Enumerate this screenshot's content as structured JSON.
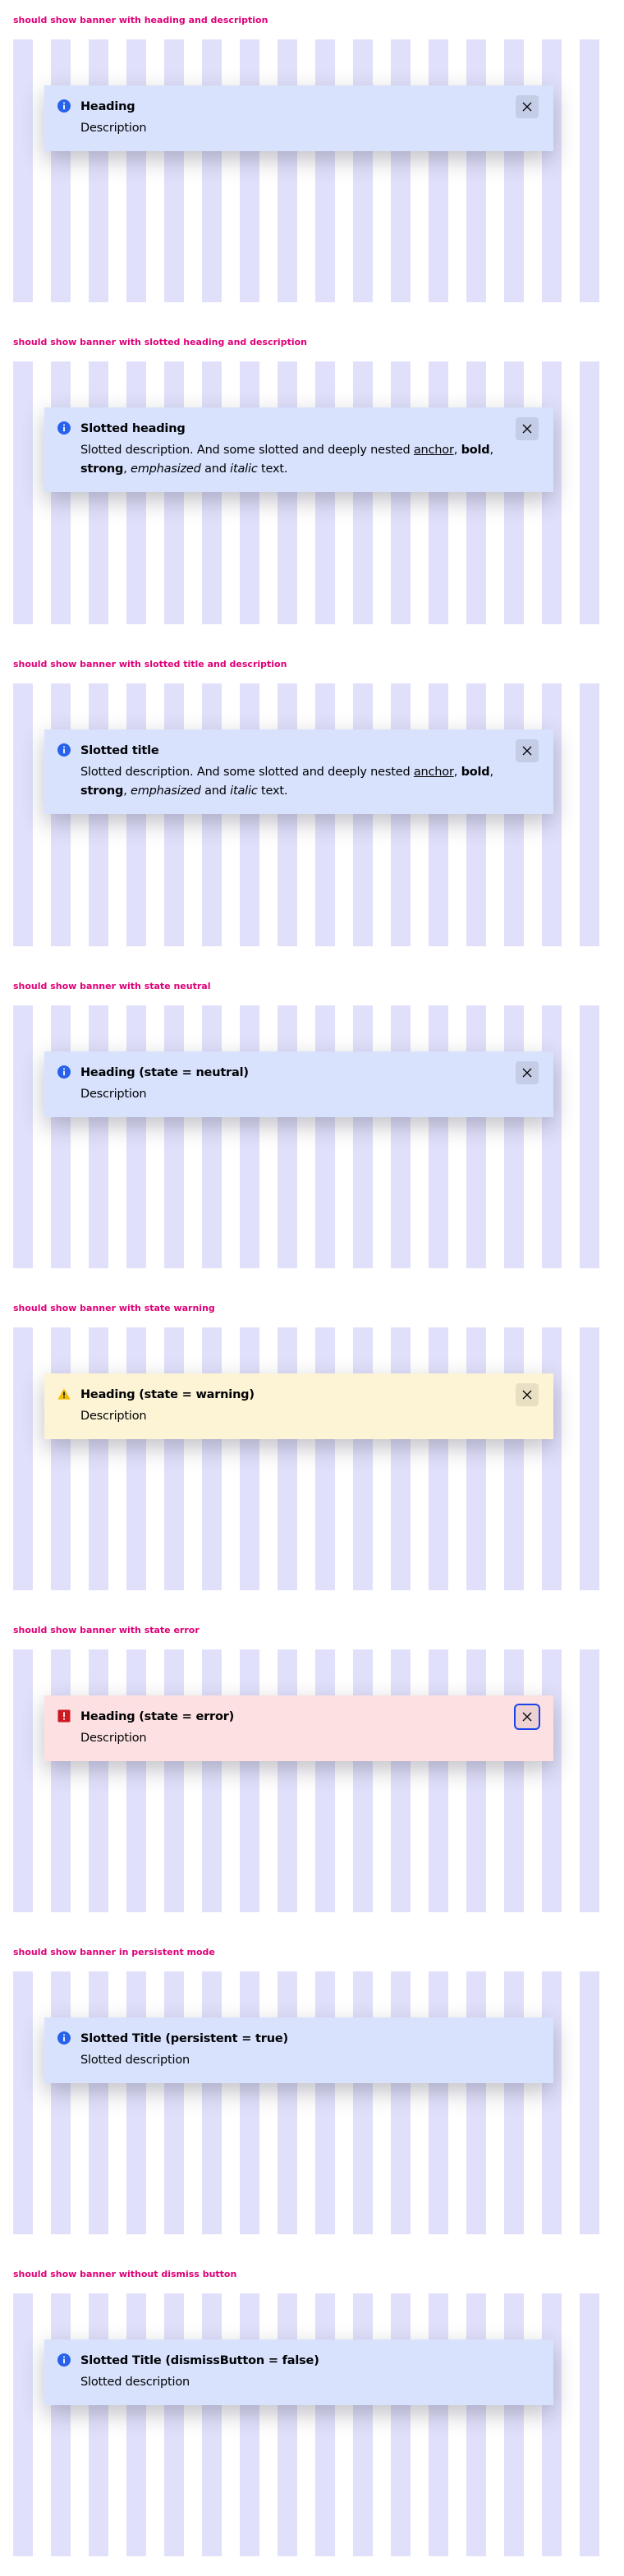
{
  "colors": {
    "info_accent": "#2762ec",
    "warning_accent": "#f3be00",
    "error_accent": "#cc1922",
    "case_title": "#de0078",
    "focus_ring": "#1a44ea",
    "info_background": "#d8e2fc",
    "warning_background": "#fdf3d5",
    "error_background": "#fde0e1"
  },
  "cases": [
    {
      "title": "should show banner with heading and description",
      "icon": "info-icon",
      "heading": "Heading",
      "description": "Description",
      "dismiss": "close-icon"
    },
    {
      "title": "should show banner with slotted heading and description",
      "icon": "info-icon",
      "heading": "Slotted heading",
      "description": {
        "before_anchor": "Slotted description. And some slotted and deeply nested ",
        "anchor": "anchor",
        "after_anchor": ", ",
        "bold": "bold",
        "after_bold": ", ",
        "strong": "strong",
        "after_strong": ", ",
        "emphasized": "emphasized",
        "between": " and ",
        "italic": "italic",
        "end": " text."
      },
      "dismiss": "close-icon"
    },
    {
      "title": "should show banner with slotted title and description",
      "icon": "info-icon",
      "heading": "Slotted title",
      "description": {
        "before_anchor": "Slotted description. And some slotted and deeply nested ",
        "anchor": "anchor",
        "after_anchor": ", ",
        "bold": "bold",
        "after_bold": ", ",
        "strong": "strong",
        "after_strong": ", ",
        "emphasized": "emphasized",
        "between": " and ",
        "italic": "italic",
        "end": " text."
      },
      "dismiss": "close-icon"
    },
    {
      "title": "should show banner with state neutral",
      "icon": "info-icon",
      "heading": "Heading (state = neutral)",
      "description": "Description",
      "dismiss": "close-icon"
    },
    {
      "title": "should show banner with state warning",
      "icon": "warning-icon",
      "heading": "Heading (state = warning)",
      "description": "Description",
      "dismiss": "close-icon"
    },
    {
      "title": "should show banner with state error",
      "icon": "error-icon",
      "heading": "Heading (state = error)",
      "description": "Description",
      "dismiss": "close-icon",
      "dismiss_focused": true
    },
    {
      "title": "should show banner in persistent mode",
      "icon": "info-icon",
      "heading": "Slotted Title (persistent = true)",
      "description": "Slotted description"
    },
    {
      "title": "should show banner without dismiss button",
      "icon": "info-icon",
      "heading": "Slotted Title (dismissButton = false)",
      "description": "Slotted description"
    }
  ]
}
